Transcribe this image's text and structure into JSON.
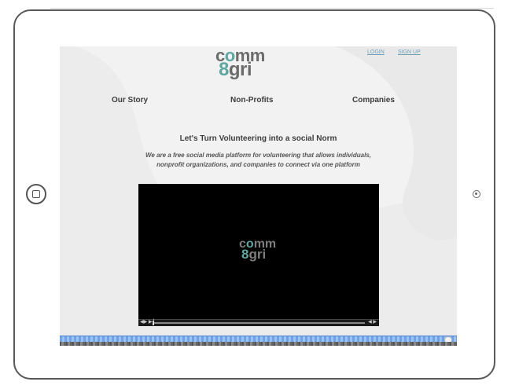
{
  "brand": {
    "logo_line1": "comm",
    "logo_line2": "8gri",
    "logo_color": "#5fa8a2"
  },
  "auth": {
    "login": "LOGIN",
    "signup": "SIGN UP"
  },
  "nav": {
    "items": [
      {
        "label": "Our Story"
      },
      {
        "label": "Non-Profits"
      },
      {
        "label": "Companies"
      }
    ]
  },
  "hero": {
    "headline": "Let's Turn Volunteering into a social Norm",
    "tagline": "We are a free social media platform for volunteering that allows individuals, nonprofit organizations, and companies to connect via one platform"
  },
  "video": {
    "logo_line1": "comm",
    "logo_line2": "8gri",
    "controls_left": "◀▶ ▶ ▏",
    "controls_right": "◀ ▶"
  },
  "device": {
    "home_button": "home-button",
    "camera": "camera"
  }
}
